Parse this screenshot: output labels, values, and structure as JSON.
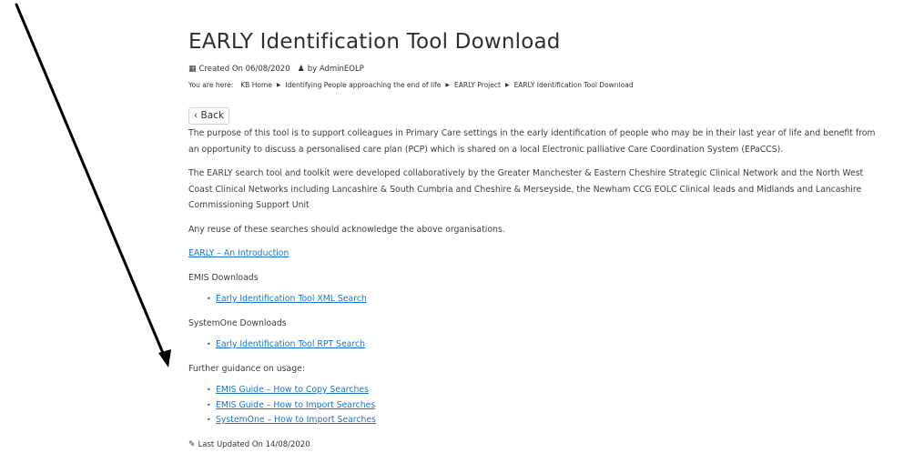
{
  "article": {
    "title": "EARLY Identification Tool Download",
    "created_label": "Created On 06/08/2020",
    "author_label": "by AdminEOLP",
    "breadcrumb": {
      "label": "You are here:",
      "items": [
        "KB Home",
        "Identifying People approaching the end of life",
        "EARLY Project",
        "EARLY Identification Tool Download"
      ]
    },
    "back_label": "Back",
    "para1": "The purpose of this tool is to support colleagues in Primary Care settings in the early identification of people who may be in their last year of life and benefit from an opportunity to discuss a personalised care plan (PCP) which is shared on a local Electronic palliative Care Coordination System (EPaCCS).",
    "para2": "The EARLY search tool and toolkit were developed collaboratively by the Greater Manchester & Eastern Cheshire Strategic Clinical Network and the North West Coast Clinical Networks including Lancashire & South Cumbria and Cheshire & Merseyside, the Newham CCG EOLC Clinical leads and Midlands and Lancashire Commissioning Support Unit",
    "para3": "Any reuse of these searches should acknowledge the above organisations.",
    "intro_link": "EARLY – An Introduction",
    "emis_heading": "EMIS Downloads",
    "emis_links": [
      "Early Identification Tool XML Search"
    ],
    "systemone_heading": "SystemOne Downloads",
    "systemone_links": [
      "Early Identification Tool RPT Search"
    ],
    "guidance_heading": "Further guidance on usage:",
    "guidance_links": [
      "EMIS Guide – How to Copy Searches",
      "EMIS Guide – How to Import Searches",
      "SystemOne – How to Import Searches"
    ],
    "updated_label": "Last Updated On 14/08/2020"
  },
  "icons": {
    "created": "calendar-icon",
    "author": "user-icon",
    "breadcrumb_sep": "triangle-right-icon",
    "back": "chevron-left-icon",
    "updated": "edit-icon"
  },
  "colors": {
    "link": "#1a75c9",
    "text": "#3d3d3d",
    "arrow": "#000000"
  }
}
